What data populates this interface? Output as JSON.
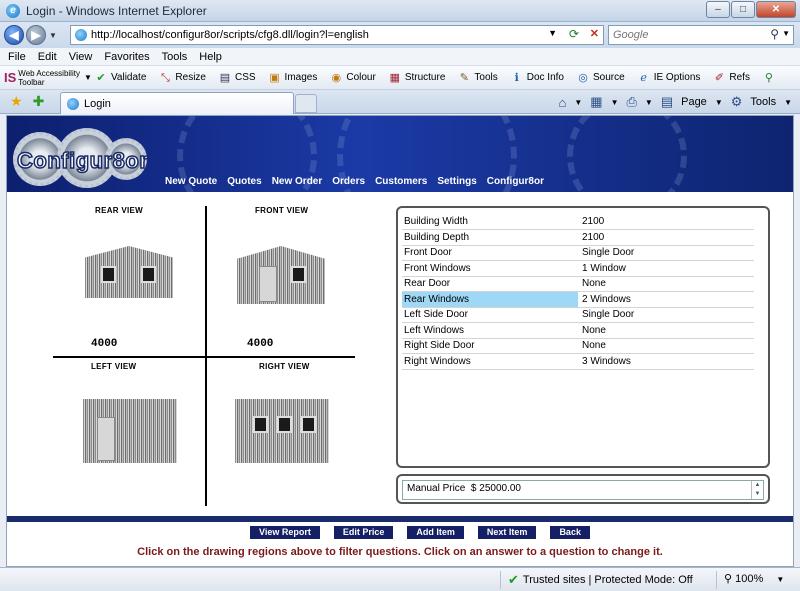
{
  "window": {
    "title": "Login - Windows Internet Explorer"
  },
  "address": {
    "url": "http://localhost/configur8or/scripts/cfg8.dll/login?l=english"
  },
  "search": {
    "placeholder": "Google"
  },
  "menu": [
    "File",
    "Edit",
    "View",
    "Favorites",
    "Tools",
    "Help"
  ],
  "wat_toolbar": {
    "logo_line1": "Web Accessibility",
    "logo_line2": "Toolbar",
    "buttons": [
      "Validate",
      "Resize",
      "CSS",
      "Images",
      "Colour",
      "Structure",
      "Tools",
      "Doc Info",
      "Source",
      "IE Options",
      "Refs"
    ]
  },
  "tab": {
    "label": "Login"
  },
  "tab_tools": {
    "page": "Page",
    "tools": "Tools"
  },
  "app": {
    "logo": "Configur8or",
    "nav": [
      "New Quote",
      "Quotes",
      "New Order",
      "Orders",
      "Customers",
      "Settings",
      "Configur8or"
    ]
  },
  "views": {
    "rear_label": "REAR VIEW",
    "front_label": "FRONT VIEW",
    "left_label": "LEFT VIEW",
    "right_label": "RIGHT VIEW",
    "rear_dim": "4000",
    "front_dim": "4000"
  },
  "spec": {
    "rows": [
      {
        "q": "Building Width",
        "a": "2100"
      },
      {
        "q": "Building Depth",
        "a": "2100"
      },
      {
        "q": "Front Door",
        "a": "Single Door"
      },
      {
        "q": "Front Windows",
        "a": "1 Window"
      },
      {
        "q": "Rear Door",
        "a": "None"
      },
      {
        "q": "Rear Windows",
        "a": "2 Windows"
      },
      {
        "q": "Left Side Door",
        "a": "Single Door"
      },
      {
        "q": "Left Windows",
        "a": "None"
      },
      {
        "q": "Right Side Door",
        "a": "None"
      },
      {
        "q": "Right Windows",
        "a": "3 Windows"
      }
    ],
    "selected_index": 5,
    "selection_color": "#9fd7f7"
  },
  "price": {
    "label": "Manual Price",
    "value": "$ 25000.00"
  },
  "actions": [
    "View Report",
    "Edit Price",
    "Add Item",
    "Next Item",
    "Back"
  ],
  "hint": "Click on the drawing regions above to filter questions. Click on an answer to a question to change it.",
  "status": {
    "zone": "Trusted sites | Protected Mode: Off",
    "zoom": "100%"
  },
  "colors": {
    "banner": "#1b3aa6",
    "button": "#141f66",
    "hint": "#7a1a1a"
  }
}
